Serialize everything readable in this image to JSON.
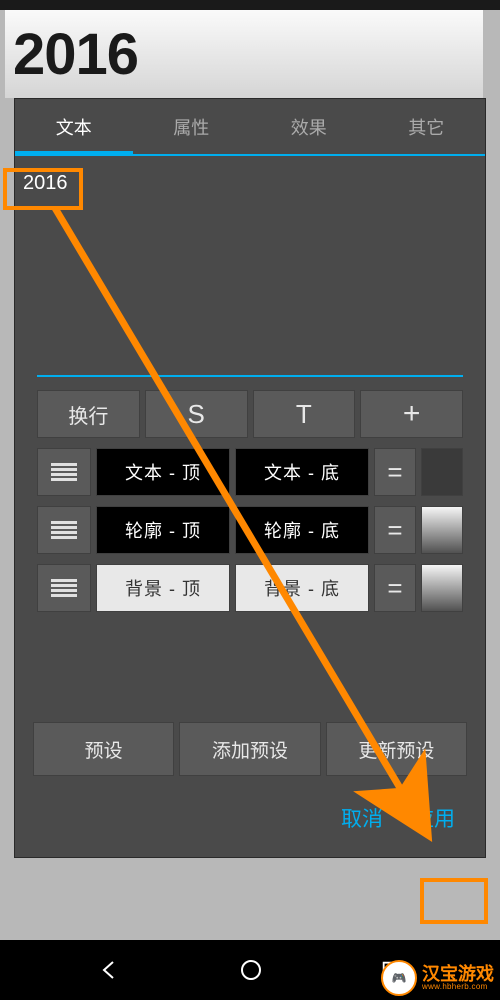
{
  "preview": {
    "text": "2016"
  },
  "tabs": {
    "items": [
      {
        "label": "文本",
        "active": true
      },
      {
        "label": "属性",
        "active": false
      },
      {
        "label": "效果",
        "active": false
      },
      {
        "label": "其它",
        "active": false
      }
    ]
  },
  "input": {
    "value": "2016"
  },
  "toolRow": {
    "wrap": "换行",
    "s": "S",
    "t": "T",
    "plus": "+"
  },
  "styleRows": [
    {
      "top": "文本 - 顶",
      "bottom": "文本 - 底",
      "variant": "dark",
      "swatch": "dark",
      "eq": "="
    },
    {
      "top": "轮廓 - 顶",
      "bottom": "轮廓 - 底",
      "variant": "dark",
      "swatch": "grad",
      "eq": "="
    },
    {
      "top": "背景 - 顶",
      "bottom": "背景 - 底",
      "variant": "light",
      "swatch": "grad",
      "eq": "="
    }
  ],
  "presets": {
    "preset": "预设",
    "add": "添加预设",
    "update": "更新预设"
  },
  "actions": {
    "cancel": "取消",
    "apply": "应用"
  },
  "watermark": {
    "title": "汉宝游戏",
    "sub": "www.hbherb.com",
    "emoji": "🎮"
  },
  "colors": {
    "accent": "#00AEEF",
    "highlight": "#ff8800"
  }
}
